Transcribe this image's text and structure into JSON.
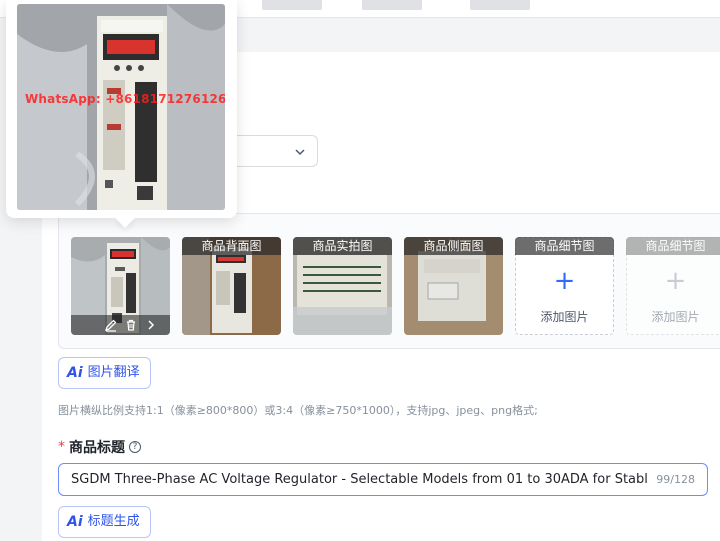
{
  "gallery": {
    "thumbs": [
      {
        "label": "",
        "kind": "front"
      },
      {
        "label": "商品背面图",
        "kind": "back"
      },
      {
        "label": "商品实拍图",
        "kind": "real"
      },
      {
        "label": "商品侧面图",
        "kind": "side"
      }
    ],
    "add_slots": [
      {
        "label": "商品细节图",
        "text": "添加图片",
        "plus": "+",
        "enabled": true
      },
      {
        "label": "商品细节图",
        "text": "添加图片",
        "plus": "+",
        "enabled": false
      }
    ]
  },
  "popover": {
    "watermark": "WhatsApp: +8618171276126"
  },
  "image_translate_button": {
    "icon": "Ai",
    "label": "图片翻译"
  },
  "image_hint": "图片横纵比例支持1:1（像素≥800*800）或3:4（像素≥750*1000），支持jpg、jpeg、png格式;",
  "title_field": {
    "required_mark": "*",
    "label": "商品标题",
    "help": "?",
    "value": "SGDM Three-Phase AC Voltage Regulator - Selectable Models from 01 to 30ADA for Stable",
    "count": "99/128"
  },
  "title_generate_button": {
    "icon": "Ai",
    "label": "标题生成"
  },
  "colors": {
    "accent": "#2f54eb",
    "required": "#f53f3f",
    "hint": "#86909c"
  }
}
